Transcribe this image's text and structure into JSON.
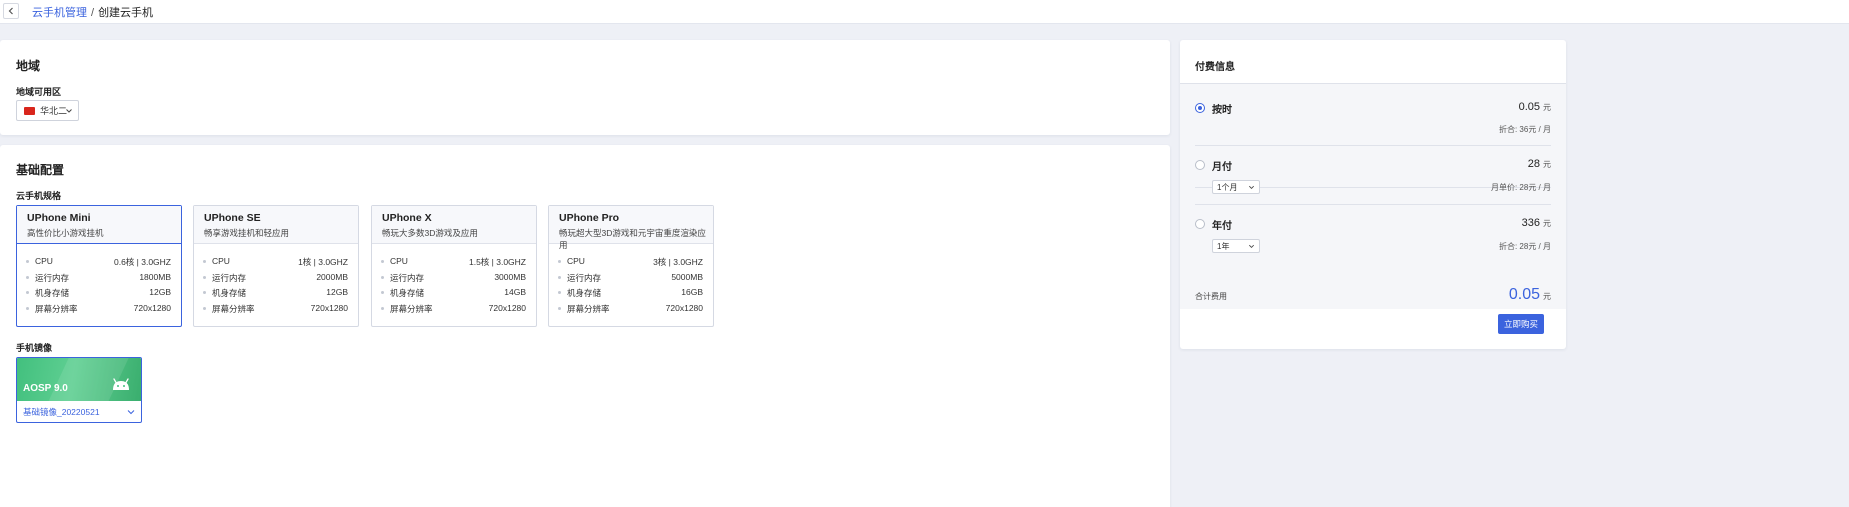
{
  "breadcrumb": {
    "parent": "云手机管理",
    "separator": "/",
    "current": "创建云手机"
  },
  "region": {
    "title": "地域",
    "zone_label": "地域可用区",
    "zone_value": "华北二"
  },
  "config": {
    "title": "基础配置",
    "spec_label": "云手机规格",
    "specs": [
      {
        "name": "UPhone Mini",
        "desc": "高性价比小游戏挂机",
        "cpu": "0.6核 | 3.0GHZ",
        "memory": "1800MB",
        "storage": "12GB",
        "resolution": "720x1280",
        "selected": true
      },
      {
        "name": "UPhone SE",
        "desc": "畅享游戏挂机和轻应用",
        "cpu": "1核 | 3.0GHZ",
        "memory": "2000MB",
        "storage": "12GB",
        "resolution": "720x1280",
        "selected": false
      },
      {
        "name": "UPhone X",
        "desc": "畅玩大多数3D游戏及应用",
        "cpu": "1.5核 | 3.0GHZ",
        "memory": "3000MB",
        "storage": "14GB",
        "resolution": "720x1280",
        "selected": false
      },
      {
        "name": "UPhone Pro",
        "desc": "畅玩超大型3D游戏和元宇宙重度渲染应用",
        "cpu": "3核 | 3.0GHZ",
        "memory": "5000MB",
        "storage": "16GB",
        "resolution": "720x1280",
        "selected": false
      }
    ],
    "spec_keys": {
      "cpu": "CPU",
      "memory": "运行内存",
      "storage": "机身存储",
      "resolution": "屏幕分辨率"
    },
    "image_label": "手机镜像",
    "image": {
      "name": "AOSP 9.0",
      "version": "基础镜像_20220521"
    }
  },
  "payment": {
    "title": "付费信息",
    "options": [
      {
        "label": "按时",
        "price": "0.05",
        "unit": "元",
        "note": "折合: 36元 / 月",
        "selected": true
      },
      {
        "label": "月付",
        "price": "28",
        "unit": "元",
        "note": "月单价: 28元 / 月",
        "select": "1个月",
        "selected": false
      },
      {
        "label": "年付",
        "price": "336",
        "unit": "元",
        "note": "折合: 28元 / 月",
        "select": "1年",
        "selected": false
      }
    ],
    "total_label": "合计费用",
    "total_price": "0.05",
    "total_unit": "元",
    "buy_label": "立即购买"
  },
  "colors": {
    "accent": "#3b63de",
    "image_green": "#42c07e",
    "flag_red": "#d9261c"
  }
}
